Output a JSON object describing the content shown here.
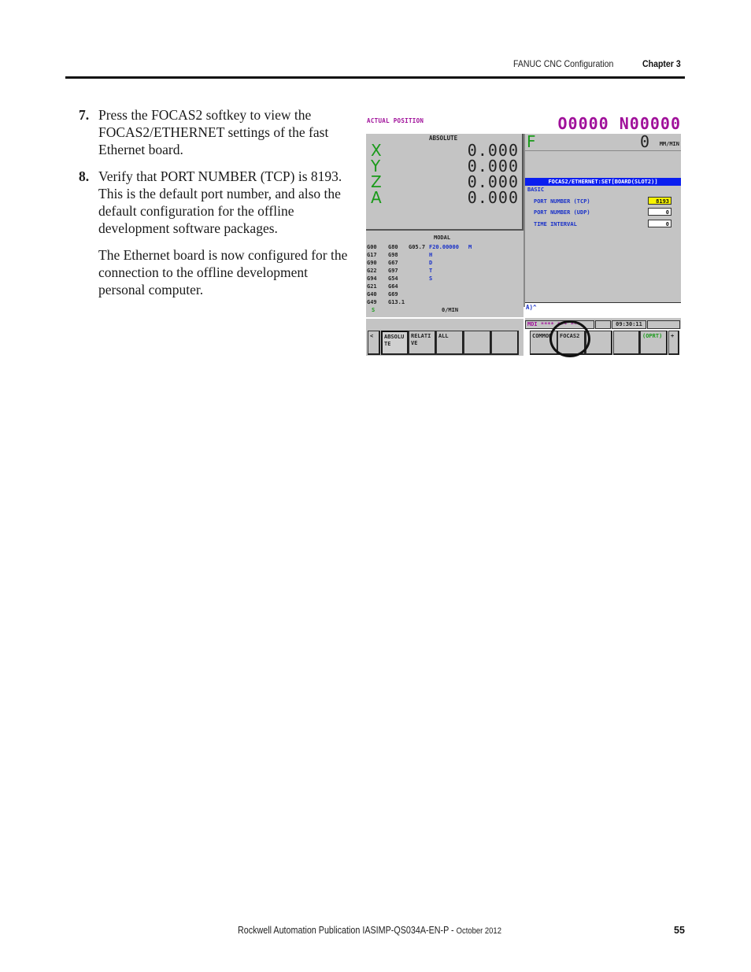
{
  "header": {
    "section": "FANUC CNC Configuration",
    "chapter": "Chapter 3"
  },
  "body": {
    "steps": [
      {
        "number": "7.",
        "text": "Press the FOCAS2 softkey to view the FOCAS2/ETHERNET settings of the fast Ethernet board."
      },
      {
        "number": "8.",
        "text": "Verify that PORT NUMBER (TCP) is 8193. This is the default port number, and also the default configuration for the offline development software packages."
      }
    ],
    "note": "The Ethernet board is now configured for the connection to the offline development personal computer."
  },
  "cnc_screen": {
    "title": "ACTUAL POSITION",
    "program_number": "O0000 N00000",
    "absolute_label": "ABSOLUTE",
    "axes": [
      {
        "name": "X",
        "value": "0.000"
      },
      {
        "name": "Y",
        "value": "0.000"
      },
      {
        "name": "Z",
        "value": "0.000"
      },
      {
        "name": "A",
        "value": "0.000"
      }
    ],
    "feed": {
      "label": "F",
      "value": "0",
      "unit": "MM/MIN"
    },
    "ethernet": {
      "title": "FOCAS2/ETHERNET:SET[BOARD(SLOT2)]",
      "section": "BASIC",
      "settings": [
        {
          "label": "PORT NUMBER (TCP)",
          "value": "8193",
          "highlighted": true
        },
        {
          "label": "PORT NUMBER (UDP)",
          "value": "0",
          "highlighted": false
        },
        {
          "label": "TIME INTERVAL",
          "value": "0",
          "highlighted": false
        }
      ]
    },
    "input_prompt": "A)^",
    "modal": {
      "title": "MODAL",
      "rows": [
        [
          "G00",
          "G80",
          "G05.7",
          "F20.00000",
          "M"
        ],
        [
          "G17",
          "G98",
          "",
          "H",
          ""
        ],
        [
          "G90",
          "G67",
          "",
          "D",
          ""
        ],
        [
          "G22",
          "G97",
          "",
          "T",
          ""
        ],
        [
          "G94",
          "G54",
          "",
          "S",
          ""
        ],
        [
          "G21",
          "G64",
          "",
          "",
          ""
        ],
        [
          "G40",
          "G69",
          "",
          "",
          ""
        ],
        [
          "G49",
          "G13.1",
          "",
          "",
          ""
        ]
      ],
      "spindle_label": "S",
      "spindle_unit": "0/MIN"
    },
    "status": {
      "mode": "MDI **** *** ***",
      "time": "09:30:11"
    },
    "left_softkeys": [
      "<",
      "ABSOLU\nTE",
      "RELATI\nVE",
      "ALL",
      "",
      ""
    ],
    "right_softkeys": [
      "COMMON",
      "FOCAS2",
      "",
      "",
      "(OPRT)",
      "+"
    ],
    "selected_left_softkey": "ABSOLUTE",
    "circled_softkey": "FOCAS2"
  },
  "footer": {
    "publication": "Rockwell Automation Publication IASIMP-QS034A-EN-P - ",
    "date": "October 2012",
    "page_number": "55"
  }
}
